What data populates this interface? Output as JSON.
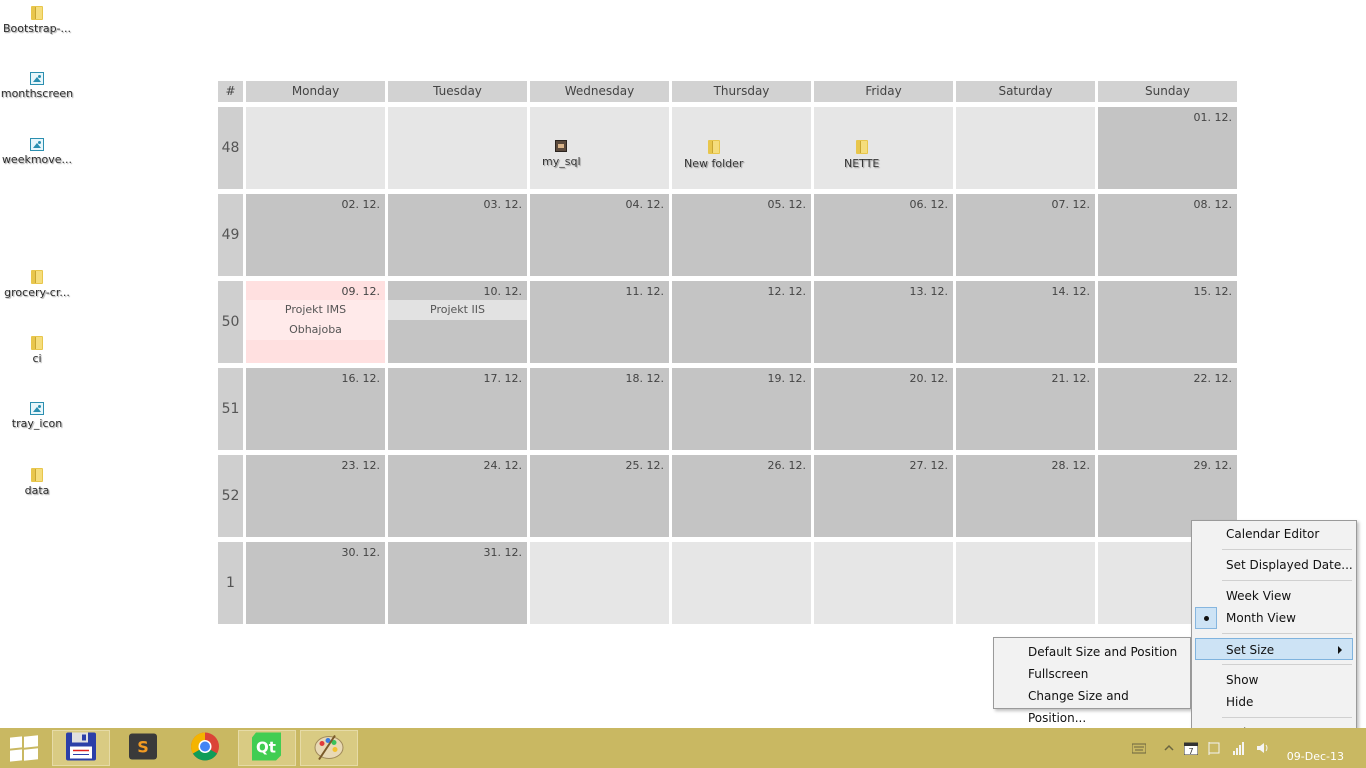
{
  "desktop_icons": [
    {
      "label": "Bootstrap-...",
      "icon": "folder-icon"
    },
    {
      "label": "monthscreen",
      "icon": "image-icon"
    },
    {
      "label": "weekmove...",
      "icon": "image-icon"
    },
    {
      "label": "grocery-cr...",
      "icon": "folder-icon"
    },
    {
      "label": "ci",
      "icon": "folder-icon"
    },
    {
      "label": "tray_icon",
      "icon": "image-icon"
    },
    {
      "label": "data",
      "icon": "folder-icon"
    }
  ],
  "calendar": {
    "week_header": "#",
    "days": [
      "Monday",
      "Tuesday",
      "Wednesday",
      "Thursday",
      "Friday",
      "Saturday",
      "Sunday"
    ],
    "weeks": [
      {
        "number": "48",
        "cells": [
          {
            "date": "",
            "state": "other"
          },
          {
            "date": "",
            "state": "other"
          },
          {
            "date": "",
            "state": "other",
            "icon": {
              "label": "my_sql",
              "type": "sql-icon"
            }
          },
          {
            "date": "",
            "state": "other",
            "icon": {
              "label": "New folder",
              "type": "folder-icon"
            }
          },
          {
            "date": "",
            "state": "other",
            "icon": {
              "label": "NETTE",
              "type": "folder-icon"
            }
          },
          {
            "date": "",
            "state": "other"
          },
          {
            "date": "01. 12.",
            "state": "cur"
          }
        ]
      },
      {
        "number": "49",
        "cells": [
          {
            "date": "02. 12.",
            "state": "cur"
          },
          {
            "date": "03. 12.",
            "state": "cur"
          },
          {
            "date": "04. 12.",
            "state": "cur"
          },
          {
            "date": "05. 12.",
            "state": "cur"
          },
          {
            "date": "06. 12.",
            "state": "cur"
          },
          {
            "date": "07. 12.",
            "state": "cur"
          },
          {
            "date": "08. 12.",
            "state": "cur"
          }
        ]
      },
      {
        "number": "50",
        "cells": [
          {
            "date": "09. 12.",
            "state": "today",
            "events": [
              "Projekt IMS",
              "Obhajoba"
            ]
          },
          {
            "date": "10. 12.",
            "state": "cur",
            "events": [
              "Projekt IIS"
            ]
          },
          {
            "date": "11. 12.",
            "state": "cur"
          },
          {
            "date": "12. 12.",
            "state": "cur"
          },
          {
            "date": "13. 12.",
            "state": "cur"
          },
          {
            "date": "14. 12.",
            "state": "cur"
          },
          {
            "date": "15. 12.",
            "state": "cur"
          }
        ]
      },
      {
        "number": "51",
        "cells": [
          {
            "date": "16. 12.",
            "state": "cur"
          },
          {
            "date": "17. 12.",
            "state": "cur"
          },
          {
            "date": "18. 12.",
            "state": "cur"
          },
          {
            "date": "19. 12.",
            "state": "cur"
          },
          {
            "date": "20. 12.",
            "state": "cur"
          },
          {
            "date": "21. 12.",
            "state": "cur"
          },
          {
            "date": "22. 12.",
            "state": "cur"
          }
        ]
      },
      {
        "number": "52",
        "cells": [
          {
            "date": "23. 12.",
            "state": "cur"
          },
          {
            "date": "24. 12.",
            "state": "cur"
          },
          {
            "date": "25. 12.",
            "state": "cur"
          },
          {
            "date": "26. 12.",
            "state": "cur"
          },
          {
            "date": "27. 12.",
            "state": "cur"
          },
          {
            "date": "28. 12.",
            "state": "cur"
          },
          {
            "date": "29. 12.",
            "state": "cur"
          }
        ]
      },
      {
        "number": "1",
        "cells": [
          {
            "date": "30. 12.",
            "state": "cur"
          },
          {
            "date": "31. 12.",
            "state": "cur"
          },
          {
            "date": "",
            "state": "other"
          },
          {
            "date": "",
            "state": "other"
          },
          {
            "date": "",
            "state": "other"
          },
          {
            "date": "",
            "state": "other"
          },
          {
            "date": "",
            "state": "other"
          }
        ]
      }
    ]
  },
  "context_menu": {
    "calendar_editor": "Calendar Editor",
    "set_displayed_date": "Set Displayed Date...",
    "week_view": "Week View",
    "month_view": "Month View",
    "month_view_checked": true,
    "set_size": "Set Size",
    "show": "Show",
    "hide": "Hide",
    "quit": "Quit"
  },
  "size_submenu": {
    "default": "Default Size and Position",
    "fullscreen": "Fullscreen",
    "change": "Change Size and Position..."
  },
  "taskbar": {
    "apps": [
      {
        "name": "floppy-app-icon",
        "active": true
      },
      {
        "name": "sublime-text-icon",
        "active": false
      },
      {
        "name": "chrome-icon",
        "active": false
      },
      {
        "name": "qt-creator-icon",
        "active": true
      },
      {
        "name": "paint-icon",
        "active": true
      }
    ],
    "clock": "09-Dec-13"
  },
  "colors": {
    "taskbar": "#c9b862",
    "cell_current": "#c4c4c4",
    "cell_other": "#e6e6e6",
    "cell_today": "#ffe0e0",
    "menu_highlight": "#cde3f5"
  }
}
